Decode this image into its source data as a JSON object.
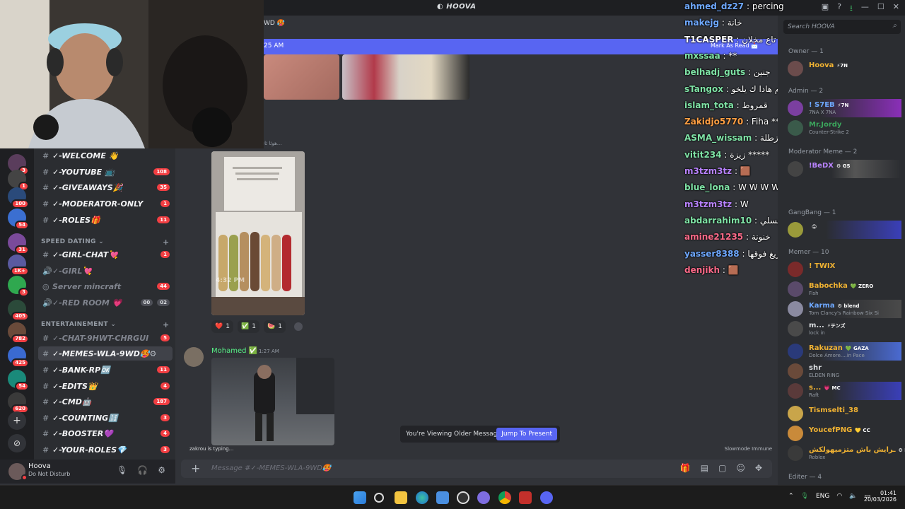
{
  "titlebar": {
    "title": "HOOVA",
    "moon": "◐"
  },
  "header": {
    "channel_fragment": "WD 🥵"
  },
  "new_messages_bar": {
    "time": "25 AM",
    "mark_as_read": "Mark As Read 📩"
  },
  "attachment_caption": "هوئا ئانا...",
  "photo_timestamp": "4:32 PM",
  "reactions": [
    {
      "icon": "❤️",
      "count": "1"
    },
    {
      "icon": "✅",
      "count": "1"
    },
    {
      "icon": "🍉",
      "count": "1"
    }
  ],
  "message": {
    "author": "Mohamed ✅",
    "time": "1:27 AM"
  },
  "older_messages": {
    "text": "You're Viewing Older Messages",
    "button": "Jump To Present"
  },
  "typing": "zakrou is typing...",
  "slowmode": "Slowmode Immune",
  "composer": {
    "placeholder": "Message #✓-MEMES-WLA-9WD🥵"
  },
  "user_panel": {
    "name": "Hoova",
    "status": "Do Not Disturb"
  },
  "servers": [
    {
      "badge": "3",
      "color": "#5a3d5c"
    },
    {
      "badge": "1",
      "color": "#444"
    },
    {
      "badge": "100",
      "color": "#2a4a7a"
    },
    {
      "badge": "54",
      "color": "#3b6fd1"
    },
    {
      "badge": "31",
      "color": "#7a4a9a"
    },
    {
      "badge": "1K+",
      "color": "#5a5aa0"
    },
    {
      "badge": "3",
      "color": "#2fa84f"
    },
    {
      "badge": "405",
      "color": "#2b4a3a"
    },
    {
      "badge": "782",
      "color": "#6a4a3a"
    },
    {
      "badge": "425",
      "color": "#3a6ad1"
    },
    {
      "badge": "54",
      "color": "#1a8a7a"
    },
    {
      "badge": "620",
      "color": "#3a3a3a"
    }
  ],
  "channels": [
    {
      "label": "✓-WELCOME 👋",
      "count": "",
      "muted": false
    },
    {
      "label": "✓-YOUTUBE 📺",
      "count": "108",
      "muted": false
    },
    {
      "label": "✓-GIVEAWAYS🎉",
      "count": "35",
      "muted": false
    },
    {
      "label": "✓-MODERATOR-ONLY",
      "count": "1",
      "muted": false
    },
    {
      "label": "✓-ROLES🎁",
      "count": "11",
      "muted": false
    }
  ],
  "category_speed": "SPEED DATING ⌄",
  "speed_channels": [
    {
      "label": "✓-GIRL-CHAT💘",
      "count": "1",
      "muted": false,
      "icon": "#"
    },
    {
      "label": "✓-GIRL💘",
      "count": "",
      "muted": true,
      "icon": "🔊"
    },
    {
      "label": "Server mincraft",
      "count": "44",
      "muted": true,
      "icon": "◎"
    },
    {
      "label": "✓-RED ROOM 💗",
      "count": "",
      "muted": true,
      "icon": "🔊",
      "grey": [
        "00",
        "02"
      ]
    }
  ],
  "category_ent": "ENTERTAINEMENT ⌄",
  "ent_channels": [
    {
      "label": "✓-CHAT-9HWT-CHRGUI",
      "count": "5",
      "muted": true
    },
    {
      "label": "✓-MEMES-WLA-9WD🥵",
      "count": "",
      "muted": false,
      "active": true
    },
    {
      "label": "✓-BANK-RP🆗",
      "count": "11",
      "muted": false
    },
    {
      "label": "✓-EDITS👑",
      "count": "4",
      "muted": false
    },
    {
      "label": "✓-CMD🤖",
      "count": "187",
      "muted": false
    },
    {
      "label": "✓-COUNTING🔢",
      "count": "3",
      "muted": false
    },
    {
      "label": "✓-BOOSTER💜",
      "count": "4",
      "muted": false
    },
    {
      "label": "✓-YOUR-ROLES💎",
      "count": "3",
      "muted": false
    }
  ],
  "overlay_chat": [
    {
      "name": "ahmed_dz27",
      "text": "percing",
      "color": "#6ea8ff"
    },
    {
      "name": "makejg",
      "text": "خانة",
      "color": "#6ea8ff"
    },
    {
      "name": "T1CASPER",
      "text": "طفية تاع مخلان",
      "color": "#ffffff"
    },
    {
      "name": "mxssaa",
      "text": "**",
      "color": "#7fe3a6"
    },
    {
      "name": "belhadj_guts",
      "text": "جنين",
      "color": "#7fe3a6"
    },
    {
      "name": "sTangox",
      "text": "يوصلك دم هادا ك يلخو",
      "color": "#7fe3a6"
    },
    {
      "name": "islam_tota",
      "text": "قمروط",
      "color": "#7fe3a6"
    },
    {
      "name": "Zakidjo5770",
      "text": "Fiha ***",
      "color": "#ff9f43"
    },
    {
      "name": "ASMA_wissam",
      "text": "بقلاوة ب زطلة 😍😋",
      "color": "#7fe3a6"
    },
    {
      "name": "vitit234",
      "text": "زيزة *****",
      "color": "#7fe3a6"
    },
    {
      "name": "m3tzm3tz",
      "text": "🟫",
      "color": "#b983ff"
    },
    {
      "name": "blue_lona",
      "text": "W W W W W W W",
      "color": "#7fe3a6"
    },
    {
      "name": "m3tzm3tz",
      "text": "W",
      "color": "#b983ff"
    },
    {
      "name": "abdarrahim10",
      "text": "نيسلي",
      "color": "#7fe3a6"
    },
    {
      "name": "amine21235",
      "text": "خنونة",
      "color": "#ff6b8a"
    },
    {
      "name": "yasser8388",
      "text": "ريغ فوقها",
      "color": "#6ea8ff"
    },
    {
      "name": "denjikh",
      "text": "🟫",
      "color": "#ff6b8a"
    }
  ],
  "member_search": "Search HOOVA",
  "member_groups": [
    {
      "label": "Owner — 1"
    },
    {
      "label": "Admin — 2"
    },
    {
      "label": "Moderator Meme — 2"
    },
    {
      "label": "GangBang — 1"
    },
    {
      "label": "Memer — 10"
    },
    {
      "label": "Editer — 4"
    }
  ],
  "members": [
    {
      "name": "Hoova",
      "tag": "⚡7N",
      "sub": "",
      "color": "#f0b232"
    },
    {
      "name": "! S7EB",
      "tag": "⚡7N",
      "sub": "7NA X 7NA",
      "color": "#6ea8ff"
    },
    {
      "name": "Mr.Jordy",
      "tag": "",
      "sub": "Counter-Strike 2",
      "color": "#3ba55c"
    },
    {
      "name": "!BeDX",
      "tag": "⚙ GS",
      "sub": "",
      "color": "#b983ff"
    },
    {
      "name": "",
      "tag": "😜",
      "sub": "",
      "color": "#f0b232"
    },
    {
      "name": "! TWIX",
      "tag": "",
      "sub": "",
      "color": "#f0b232"
    },
    {
      "name": "Babochka",
      "tag": "💚 ZERO",
      "sub": "Fish",
      "color": "#f0b232"
    },
    {
      "name": "Karma",
      "tag": "⚙ blend",
      "sub": "Tom Clancy's Rainbow Six Si",
      "color": "#6ea8ff"
    },
    {
      "name": "m...",
      "tag": "⚡テンズ",
      "sub": "lock in",
      "color": "#dbdee1"
    },
    {
      "name": "Rakuzan",
      "tag": "💚 GAZA",
      "sub": "Dolce Amore....in Pace",
      "color": "#f0b232"
    },
    {
      "name": "shr",
      "tag": "",
      "sub": "ELDEN RING",
      "color": "#dbdee1"
    },
    {
      "name": "s...",
      "tag": "💗 MC",
      "sub": "Raft",
      "color": "#f0b232"
    },
    {
      "name": "Tismselti_38",
      "tag": "",
      "sub": "",
      "color": "#f0b232"
    },
    {
      "name": "YoucefPNG",
      "tag": "💛 CC",
      "sub": "",
      "color": "#f0b232"
    },
    {
      "name": "ـرايش باش متزميهولكش",
      "tag": "⚙ EGO",
      "sub": "Roblox",
      "color": "#f0b232"
    }
  ],
  "tray": {
    "lang": "ENG",
    "time": "01:41",
    "date": "20/03/2026"
  }
}
